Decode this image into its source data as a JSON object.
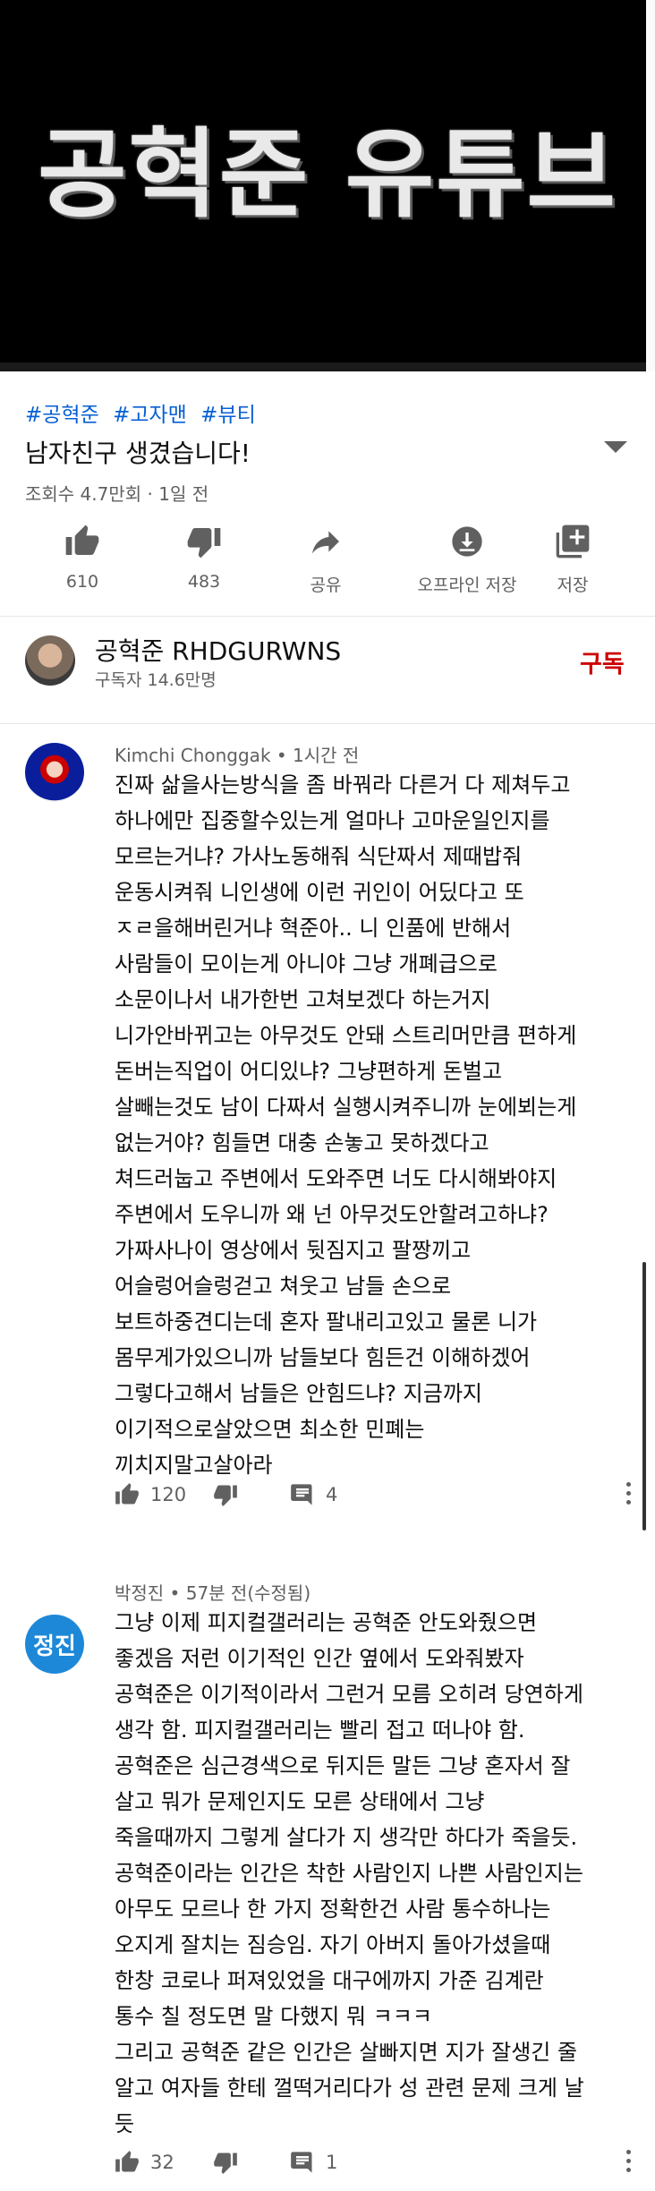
{
  "video": {
    "banner_text": "공혁준 유튜브",
    "hashtags": [
      "#공혁준",
      "#고자맨",
      "#뷰티"
    ],
    "title": "남자친구 생겼습니다!",
    "meta": "조회수 4.7만회 · 1일 전"
  },
  "actions": [
    {
      "icon": "thumbs-up-icon",
      "label": "610"
    },
    {
      "icon": "thumbs-down-icon",
      "label": "483"
    },
    {
      "icon": "share-icon",
      "label": "공유"
    },
    {
      "icon": "download-icon",
      "label": "오프라인 저장"
    },
    {
      "icon": "save-playlist-icon",
      "label": "저장"
    }
  ],
  "channel": {
    "name": "공혁준 RHDGURWNS",
    "subscribers": "구독자 14.6만명",
    "subscribe_label": "구독"
  },
  "comments": [
    {
      "author": "Kimchi Chonggak",
      "time": "1시간 전",
      "text": "진짜 삶을사는방식을 좀 바꿔라 다른거 다 제쳐두고\n하나에만 집중할수있는게 얼마나 고마운일인지를\n모르는거냐? 가사노동해줘 식단짜서 제때밥줘\n운동시켜줘 니인생에 이런 귀인이 어딨다고 또\nㅈㄹ을해버린거냐 혁준아.. 니 인품에 반해서\n사람들이 모이는게 아니야 그냥 개폐급으로\n소문이나서 내가한번 고쳐보겠다 하는거지\n니가안바뀌고는 아무것도 안돼 스트리머만큼 편하게\n돈버는직업이 어디있냐? 그냥편하게 돈벌고\n살빼는것도 남이 다짜서 실행시켜주니까 눈에뵈는게\n없는거야? 힘들면 대충 손놓고 못하겠다고\n쳐드러눕고 주변에서 도와주면 너도 다시해봐야지\n주변에서 도우니까 왜 넌 아무것도안할려고하냐?\n가짜사나이 영상에서 뒷짐지고 팔짱끼고\n어슬렁어슬렁걷고 쳐웃고 남들 손으로\n보트하중견디는데 혼자 팔내리고있고 물론 니가\n몸무게가있으니까 남들보다 힘든건 이해하겠어\n그렇다고해서 남들은 안힘드냐? 지금까지\n이기적으로살았으면 최소한 민폐는\n끼치지말고살아라",
      "likes": "120",
      "replies": "4"
    },
    {
      "author": "박정진",
      "avatar_text": "정진",
      "time": "57분 전(수정됨)",
      "text": "그냥 이제 피지컬갤러리는 공혁준 안도와줬으면\n좋겠음 저런 이기적인 인간 옆에서 도와줘봤자\n공혁준은 이기적이라서 그런거 모름 오히려 당연하게\n생각 함. 피지컬갤러리는 빨리 접고 떠나야 함.\n공혁준은 심근경색으로 뒤지든 말든 그냥 혼자서 잘\n살고 뭐가 문제인지도 모른 상태에서 그냥\n죽을때까지 그렇게 살다가 지 생각만 하다가 죽을듯.\n공혁준이라는 인간은 착한 사람인지 나쁜 사람인지는\n아무도 모르나 한 가지 정확한건 사람 통수하나는\n오지게 잘치는 짐승임. 자기 아버지 돌아가셨을때\n한창 코로나 퍼져있었을 대구에까지 가준 김계란\n통수 칠 정도면 말 다했지 뭐 ㅋㅋㅋ\n그리고 공혁준 같은 인간은 살빠지면 지가 잘생긴 줄\n알고 여자들 한테 껄떡거리다가 성 관련 문제 크게 날\n듯",
      "likes": "32",
      "replies": "1"
    }
  ]
}
